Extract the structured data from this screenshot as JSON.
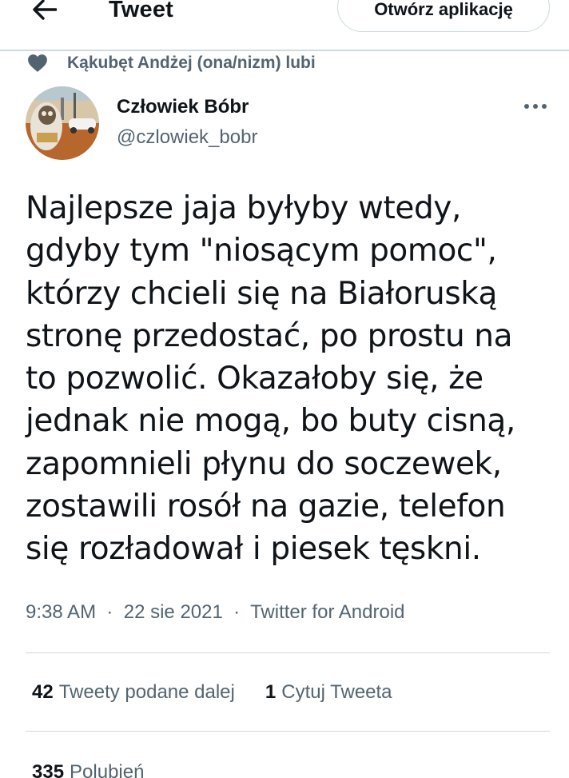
{
  "header": {
    "title": "Tweet",
    "open_app_label": "Otwórz aplikację"
  },
  "social_context": {
    "text": "Kąkubęt Andżej (ona/nizm) lubi"
  },
  "author": {
    "name": "Człowiek Bóbr",
    "handle": "@czlowiek_bobr"
  },
  "tweet": {
    "lines": [
      "Najlepsze jaja byłyby wtedy,",
      "gdyby tym \"niosącym pomoc\",",
      "którzy chcieli się na Białoruską",
      "stronę przedostać, po prostu na",
      "to pozwolić. Okazałoby się, że",
      "jednak nie mogą, bo buty cisną,",
      "zapomnieli płynu do soczewek,",
      "zostawili rosół na gazie, telefon",
      "się rozładował i piesek tęskni."
    ],
    "time": "9:38 AM",
    "date": "22 sie 2021",
    "source": "Twitter for Android",
    "separator": "·"
  },
  "stats": {
    "retweets_count": "42",
    "retweets_label": "Tweety podane dalej",
    "quotes_count": "1",
    "quotes_label": "Cytuj Tweeta",
    "likes_count": "335",
    "likes_label": "Polubień"
  },
  "colors": {
    "text_primary": "#0f1419",
    "text_secondary": "#536471",
    "border": "#cfd9de",
    "heart_icon": "#536471"
  },
  "icons": {
    "back": "arrow-left-icon",
    "liked": "heart-icon",
    "more": "more-dots-icon"
  }
}
